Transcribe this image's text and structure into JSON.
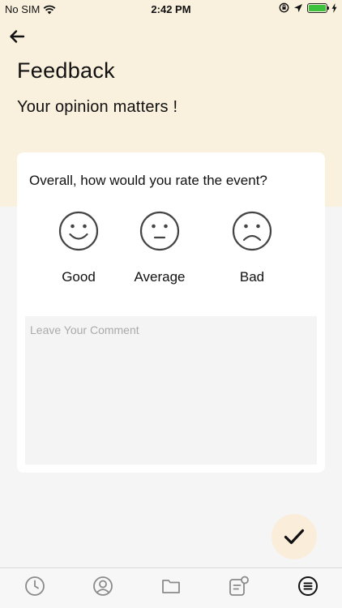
{
  "status_bar": {
    "carrier": "No SIM",
    "time": "2:42 PM",
    "battery_color": "#3ec23e"
  },
  "header": {
    "back_icon": "arrow-left-icon",
    "title": "Feedback",
    "subtitle": "Your opinion matters !"
  },
  "card": {
    "question": "Overall, how would you rate the event?",
    "ratings": [
      {
        "label": "Good",
        "icon": "smiley-face-icon"
      },
      {
        "label": "Average",
        "icon": "neutral-face-icon"
      },
      {
        "label": "Bad",
        "icon": "sad-face-icon"
      }
    ],
    "comment": {
      "placeholder": "Leave Your Comment",
      "value": ""
    }
  },
  "submit_icon": "checkmark-icon",
  "tab_bar": {
    "tabs": [
      {
        "icon": "clock-icon"
      },
      {
        "icon": "user-circle-icon"
      },
      {
        "icon": "folder-icon"
      },
      {
        "icon": "notes-badge-icon"
      },
      {
        "icon": "menu-circle-icon",
        "active": true
      }
    ]
  },
  "colors": {
    "header_background": "#faf0de",
    "page_background": "#f5f5f5",
    "fab_background": "#faeedb"
  }
}
